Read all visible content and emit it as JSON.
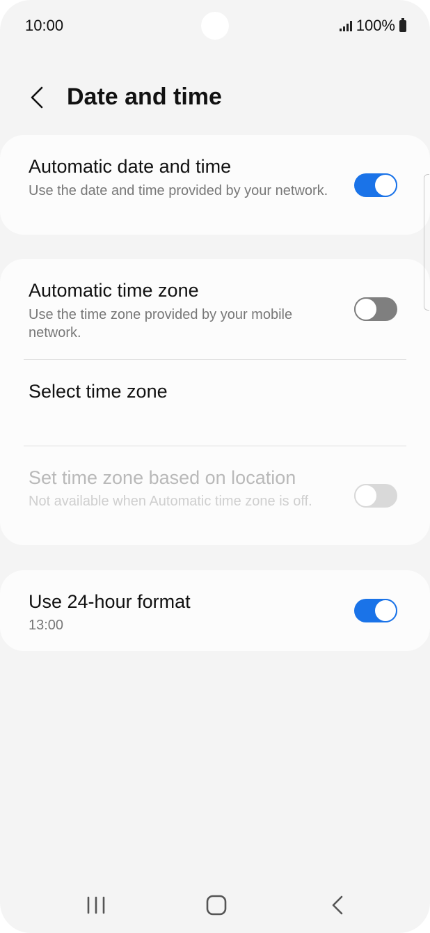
{
  "status_bar": {
    "time": "10:00",
    "battery_percent": "100%",
    "signal_icon": "signal-icon",
    "battery_icon": "battery-icon"
  },
  "header": {
    "title": "Date and time",
    "back_icon": "chevron-left-icon"
  },
  "settings": {
    "automatic_date_time": {
      "title": "Automatic date and time",
      "subtitle": "Use the date and time provided by your network.",
      "enabled": true
    },
    "automatic_time_zone": {
      "title": "Automatic time zone",
      "subtitle": "Use the time zone provided by your mobile network.",
      "enabled": false
    },
    "select_time_zone": {
      "title": "Select time zone"
    },
    "time_zone_location": {
      "title": "Set time zone based on location",
      "subtitle": "Not available when Automatic time zone is off.",
      "enabled": false,
      "disabled": true
    },
    "use_24_hour": {
      "title": "Use 24-hour format",
      "subtitle": "13:00",
      "enabled": true
    }
  },
  "navigation_bar": {
    "recents_icon": "recents-icon",
    "home_icon": "home-icon",
    "back_icon": "back-icon"
  },
  "colors": {
    "accent": "#1a73e8",
    "background": "#f4f4f4",
    "card": "#fcfcfc"
  }
}
